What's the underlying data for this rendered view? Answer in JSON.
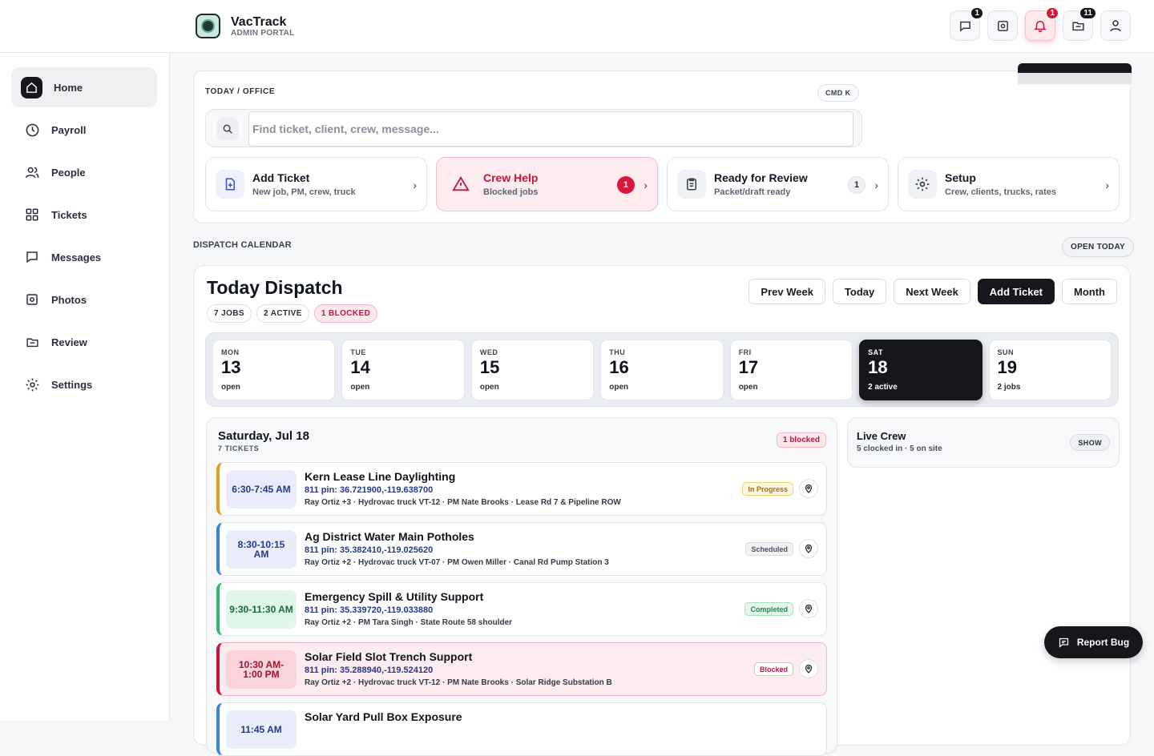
{
  "app": {
    "name": "VacTrack",
    "subtitle": "ADMIN PORTAL"
  },
  "header_icons": [
    {
      "icon": "chat-icon",
      "badge": "1"
    },
    {
      "icon": "photo-icon",
      "badge": ""
    },
    {
      "icon": "bell-icon",
      "badge": "1"
    },
    {
      "icon": "review-folder-icon",
      "badge": "11"
    },
    {
      "icon": "user-icon",
      "badge": ""
    }
  ],
  "sidebar": {
    "items": [
      {
        "label": "Home",
        "icon": "home-icon"
      },
      {
        "label": "Payroll",
        "icon": "clock-icon"
      },
      {
        "label": "People",
        "icon": "people-icon"
      },
      {
        "label": "Tickets",
        "icon": "grid-icon"
      },
      {
        "label": "Messages",
        "icon": "message-icon"
      },
      {
        "label": "Photos",
        "icon": "photo-icon"
      },
      {
        "label": "Review",
        "icon": "folder-icon"
      },
      {
        "label": "Settings",
        "icon": "gear-icon"
      }
    ]
  },
  "office": {
    "breadcrumb": "TODAY / OFFICE",
    "shortcut": "CMD K",
    "search_placeholder": "Find ticket, client, crew, message...",
    "quick_actions": [
      {
        "title": "Add Ticket",
        "sub": "New job, PM, crew, truck",
        "count": ""
      },
      {
        "title": "Crew Help",
        "sub": "Blocked jobs",
        "count": "1"
      },
      {
        "title": "Ready for Review",
        "sub": "Packet/draft ready",
        "count": "1"
      },
      {
        "title": "Setup",
        "sub": "Crew, clients, trucks, rates",
        "count": ""
      }
    ]
  },
  "calendar": {
    "section_label": "DISPATCH CALENDAR",
    "open_today": "OPEN TODAY",
    "title": "Today Dispatch",
    "chips": [
      "7 JOBS",
      "2 ACTIVE",
      "1 BLOCKED"
    ],
    "actions": [
      "Prev Week",
      "Today",
      "Next Week",
      "Add Ticket",
      "Month"
    ],
    "days": [
      {
        "name": "MON",
        "num": "13",
        "status": "open"
      },
      {
        "name": "TUE",
        "num": "14",
        "status": "open"
      },
      {
        "name": "WED",
        "num": "15",
        "status": "open"
      },
      {
        "name": "THU",
        "num": "16",
        "status": "open"
      },
      {
        "name": "FRI",
        "num": "17",
        "status": "open"
      },
      {
        "name": "SAT",
        "num": "18",
        "status": "2 active"
      },
      {
        "name": "SUN",
        "num": "19",
        "status": "2 jobs"
      }
    ],
    "selected_day": "SAT"
  },
  "day_panel": {
    "title": "Saturday, Jul 18",
    "sub": "7 TICKETS",
    "badge": "1 blocked",
    "tickets": [
      {
        "time": "6:30-7:45 AM",
        "title": "Kern Lease Line Daylighting",
        "pin": "811 pin: 36.721900,-119.638700",
        "meta": "Ray Ortiz +3 · Hydrovac truck VT-12 · PM Nate Brooks · Lease Rd 7 & Pipeline ROW",
        "status": "In Progress",
        "accent": "#e39b1d"
      },
      {
        "time": "8:30-10:15 AM",
        "title": "Ag District Water Main Potholes",
        "pin": "811 pin: 35.382410,-119.025620",
        "meta": "Ray Ortiz +2 · Hydrovac truck VT-07 · PM Owen Miller · Canal Rd Pump Station 3",
        "status": "Scheduled",
        "accent": "#3b82e0"
      },
      {
        "time": "9:30-11:30 AM",
        "title": "Emergency Spill & Utility Support",
        "pin": "811 pin: 35.339720,-119.033880",
        "meta": "Ray Ortiz +2 · PM Tara Singh · State Route 58 shoulder",
        "status": "Completed",
        "accent": "#2eb86a"
      },
      {
        "time": "10:30 AM-1:00 PM",
        "title": "Solar Field Slot Trench Support",
        "pin": "811 pin: 35.288940,-119.524120",
        "meta": "Ray Ortiz +2 · Hydrovac truck VT-12 · PM Nate Brooks · Solar Ridge Substation B",
        "status": "Blocked",
        "accent": "#c0173a"
      },
      {
        "time": "11:45 AM",
        "title": "Solar Yard Pull Box Exposure",
        "pin": "",
        "meta": "",
        "status": "",
        "accent": "#3b82e0"
      }
    ]
  },
  "live_crew": {
    "title": "Live Crew",
    "sub": "5 clocked in · 5 on site",
    "show": "SHOW"
  },
  "report_bug": "Report Bug"
}
